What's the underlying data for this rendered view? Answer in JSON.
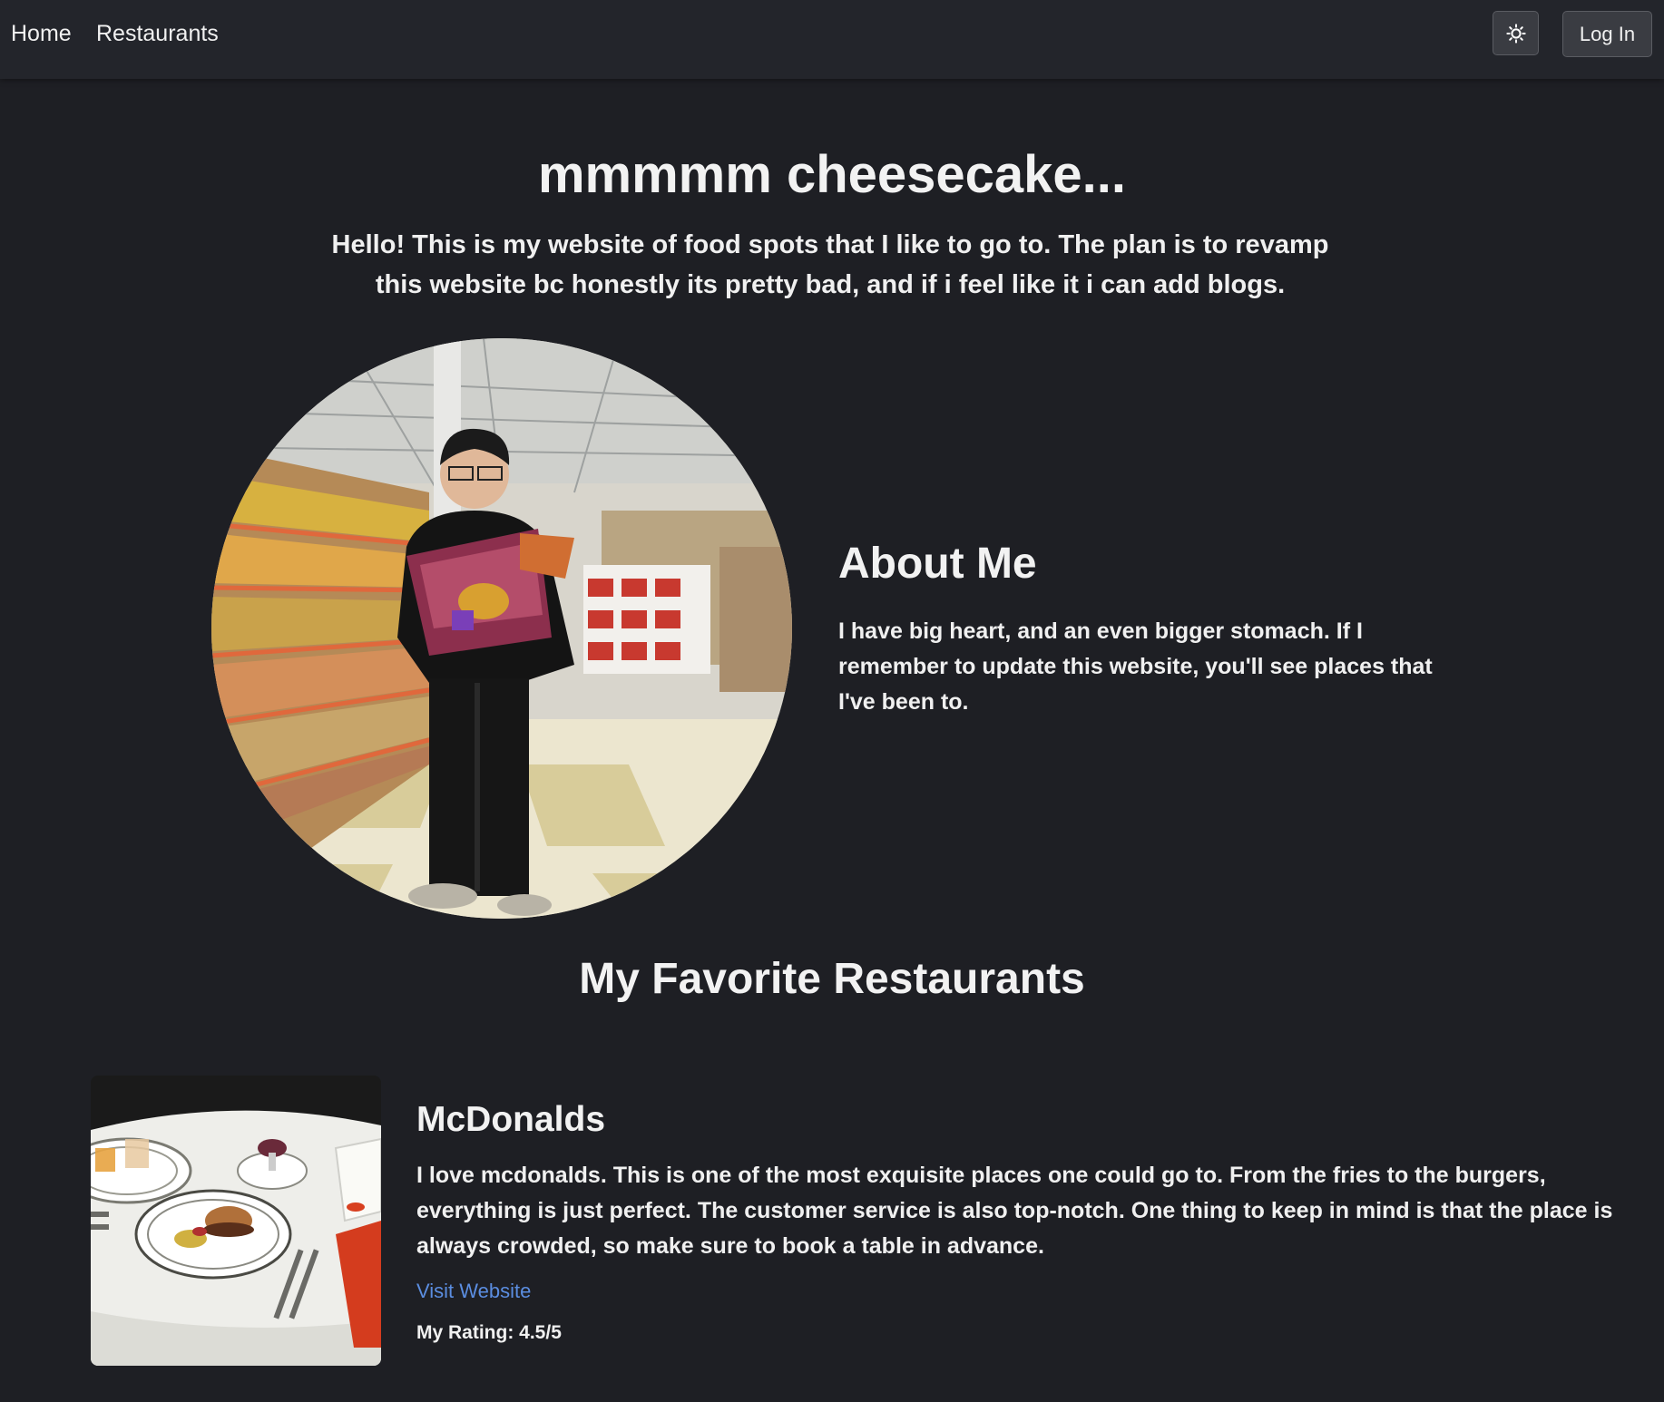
{
  "nav": {
    "links": [
      "Home",
      "Restaurants"
    ],
    "theme_icon": "sun-icon",
    "login_label": "Log In"
  },
  "hero": {
    "title": "mmmmm cheesecake...",
    "subtitle": "Hello! This is my website of food spots that I like to go to. The plan is to revamp this website bc honestly its pretty bad, and if i feel like it i can add blogs."
  },
  "about": {
    "heading": "About Me",
    "text": "I have big heart, and an even bigger stomach. If I remember to update this website, you'll see places that I've been to."
  },
  "favorites": {
    "heading": "My Favorite Restaurants",
    "items": [
      {
        "name": "McDonalds",
        "description": "I love mcdonalds. This is one of the most exquisite places one could go to. From the fries to the burgers, everything is just perfect. The customer service is also top-notch. One thing to keep in mind is that the place is always crowded, so make sure to book a table in advance.",
        "link_label": "Visit Website",
        "rating": "My Rating: 4.5/5"
      }
    ]
  },
  "colors": {
    "background": "#1e1f24",
    "navbar": "#23252b",
    "link": "#5b8de0",
    "text": "#f0f0f0"
  }
}
